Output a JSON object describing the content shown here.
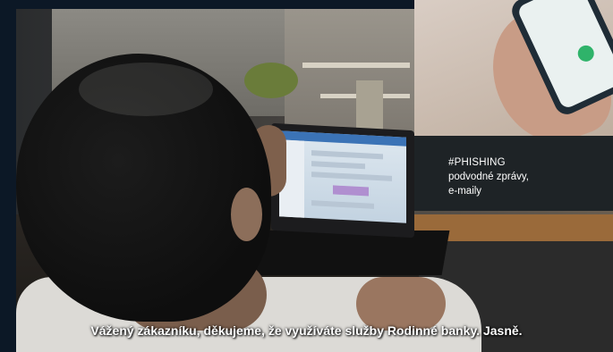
{
  "overlay": {
    "hashtag": "#PHISHING",
    "lines": [
      "podvodné zprávy,",
      "e-maily"
    ]
  },
  "subtitle": "Vážený zákazníku, děkujeme, že využíváte služby Rodinné banky. Jasně.",
  "colors": {
    "background": "#0c1826",
    "caption_box": "#1e2326",
    "text": "#ffffff",
    "phone_button": "#2fb36a"
  }
}
